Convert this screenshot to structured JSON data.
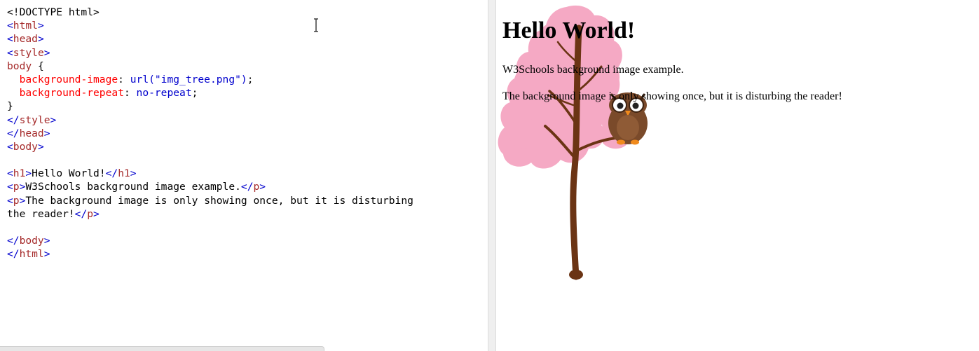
{
  "editor": {
    "lines": [
      [
        {
          "c": "plain",
          "t": "<!DOCTYPE html>"
        }
      ],
      [
        {
          "c": "tag",
          "t": "<"
        },
        {
          "c": "tname",
          "t": "html"
        },
        {
          "c": "tag",
          "t": ">"
        }
      ],
      [
        {
          "c": "tag",
          "t": "<"
        },
        {
          "c": "tname",
          "t": "head"
        },
        {
          "c": "tag",
          "t": ">"
        }
      ],
      [
        {
          "c": "tag",
          "t": "<"
        },
        {
          "c": "tname",
          "t": "style"
        },
        {
          "c": "tag",
          "t": ">"
        }
      ],
      [
        {
          "c": "sel",
          "t": "body"
        },
        {
          "c": "plain",
          "t": " {"
        }
      ],
      [
        {
          "c": "plain",
          "t": "  "
        },
        {
          "c": "prop",
          "t": "background-image"
        },
        {
          "c": "plain",
          "t": ": "
        },
        {
          "c": "val",
          "t": "url(\"img_tree.png\")"
        },
        {
          "c": "plain",
          "t": ";"
        }
      ],
      [
        {
          "c": "plain",
          "t": "  "
        },
        {
          "c": "prop",
          "t": "background-repeat"
        },
        {
          "c": "plain",
          "t": ": "
        },
        {
          "c": "val",
          "t": "no-repeat"
        },
        {
          "c": "plain",
          "t": ";"
        }
      ],
      [
        {
          "c": "plain",
          "t": "}"
        }
      ],
      [
        {
          "c": "tag",
          "t": "</"
        },
        {
          "c": "tname",
          "t": "style"
        },
        {
          "c": "tag",
          "t": ">"
        }
      ],
      [
        {
          "c": "tag",
          "t": "</"
        },
        {
          "c": "tname",
          "t": "head"
        },
        {
          "c": "tag",
          "t": ">"
        }
      ],
      [
        {
          "c": "tag",
          "t": "<"
        },
        {
          "c": "tname",
          "t": "body"
        },
        {
          "c": "tag",
          "t": ">"
        }
      ],
      [],
      [
        {
          "c": "tag",
          "t": "<"
        },
        {
          "c": "tname",
          "t": "h1"
        },
        {
          "c": "tag",
          "t": ">"
        },
        {
          "c": "plain",
          "t": "Hello World!"
        },
        {
          "c": "tag",
          "t": "</"
        },
        {
          "c": "tname",
          "t": "h1"
        },
        {
          "c": "tag",
          "t": ">"
        }
      ],
      [
        {
          "c": "tag",
          "t": "<"
        },
        {
          "c": "tname",
          "t": "p"
        },
        {
          "c": "tag",
          "t": ">"
        },
        {
          "c": "plain",
          "t": "W3Schools background image example."
        },
        {
          "c": "tag",
          "t": "</"
        },
        {
          "c": "tname",
          "t": "p"
        },
        {
          "c": "tag",
          "t": ">"
        }
      ],
      [
        {
          "c": "tag",
          "t": "<"
        },
        {
          "c": "tname",
          "t": "p"
        },
        {
          "c": "tag",
          "t": ">"
        },
        {
          "c": "plain",
          "t": "The background image is only showing once, but it is disturbing"
        }
      ],
      [
        {
          "c": "plain",
          "t": "the reader!"
        },
        {
          "c": "tag",
          "t": "</"
        },
        {
          "c": "tname",
          "t": "p"
        },
        {
          "c": "tag",
          "t": ">"
        }
      ],
      [],
      [
        {
          "c": "tag",
          "t": "</"
        },
        {
          "c": "tname",
          "t": "body"
        },
        {
          "c": "tag",
          "t": ">"
        }
      ],
      [
        {
          "c": "tag",
          "t": "</"
        },
        {
          "c": "tname",
          "t": "html"
        },
        {
          "c": "tag",
          "t": ">"
        }
      ]
    ]
  },
  "result": {
    "heading": "Hello World!",
    "paragraph1": "W3Schools background image example.",
    "paragraph2": "The background image is only showing once, but it is disturbing the reader!"
  },
  "colors": {
    "tree_blossom": "#f5a9c4",
    "tree_trunk": "#6b3414",
    "owl_body": "#7a4a2a",
    "owl_feet": "#f08a1c"
  },
  "icons": [
    "text-cursor-icon",
    "tree-owl-background-image"
  ]
}
